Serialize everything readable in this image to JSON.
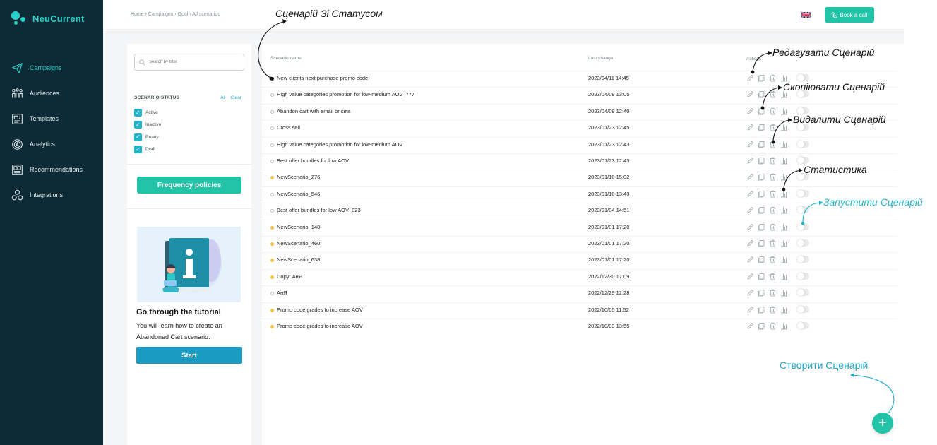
{
  "app": {
    "name": "NeuCurrent"
  },
  "sidebar": {
    "items": [
      {
        "label": "Campaigns",
        "icon": "paper-plane-icon",
        "active": true
      },
      {
        "label": "Audiences",
        "icon": "people-icon"
      },
      {
        "label": "Templates",
        "icon": "template-icon"
      },
      {
        "label": "Analytics",
        "icon": "analytics-icon"
      },
      {
        "label": "Recommendations",
        "icon": "recommendations-icon"
      },
      {
        "label": "Integrations",
        "icon": "integrations-icon"
      }
    ]
  },
  "topbar": {
    "breadcrumb": "Home › Campaigns › Goal › All scenarios",
    "language_icon": "uk-flag-icon",
    "book_call_label": "Book a call"
  },
  "filters": {
    "search_placeholder": "Search by filter",
    "status_title": "SCENARIO STATUS",
    "all_label": "All",
    "clear_label": "Clear",
    "statuses": [
      {
        "label": "Active",
        "checked": true
      },
      {
        "label": "Inactive",
        "checked": true
      },
      {
        "label": "Ready",
        "checked": true
      },
      {
        "label": "Draft",
        "checked": true
      }
    ],
    "frequency_label": "Frequency policies"
  },
  "tutorial": {
    "title": "Go through the tutorial",
    "text": "You will learn how to create an Abandoned Cart scenario.",
    "start_label": "Start"
  },
  "table": {
    "col_name": "Scenario name",
    "col_date": "Last change",
    "col_actions": "Actions",
    "rows": [
      {
        "name": "New clients next purchase promo code",
        "date": "2023/04/11 14:45",
        "status": "active"
      },
      {
        "name": "High value categories promotion for low-medium AOV_777",
        "date": "2023/04/09 13:05",
        "status": "inactive"
      },
      {
        "name": "Abandon cart with email or sms",
        "date": "2023/04/09 12:40",
        "status": "inactive"
      },
      {
        "name": "Cross sell",
        "date": "2023/01/23 12:45",
        "status": "inactive"
      },
      {
        "name": "High value categories promotion for low-medium AOV",
        "date": "2023/01/23 12:43",
        "status": "inactive"
      },
      {
        "name": "Best offer bundles for low AOV",
        "date": "2023/01/23 12:43",
        "status": "inactive"
      },
      {
        "name": "NewScenario_276",
        "date": "2023/01/10 15:02",
        "status": "draft"
      },
      {
        "name": "NewScenario_546",
        "date": "2023/01/10 13:43",
        "status": "inactive"
      },
      {
        "name": "Best offer bundles for low AOV_823",
        "date": "2023/01/04 14:51",
        "status": "inactive"
      },
      {
        "name": "NewScenario_148",
        "date": "2023/01/01 17:20",
        "status": "draft"
      },
      {
        "name": "NewScenario_460",
        "date": "2023/01/01 17:20",
        "status": "draft"
      },
      {
        "name": "NewScenario_638",
        "date": "2023/01/01 17:20",
        "status": "draft"
      },
      {
        "name": "Copy: АнЯ",
        "date": "2022/12/30 17:09",
        "status": "draft"
      },
      {
        "name": "АнЯ",
        "date": "2022/12/29 12:28",
        "status": "inactive"
      },
      {
        "name": "Promo code grades to increase AOV",
        "date": "2022/10/05 11:52",
        "status": "draft"
      },
      {
        "name": "Promo code grades to increase AOV",
        "date": "2022/10/03 13:55",
        "status": "draft"
      }
    ]
  },
  "status_colors": {
    "active": "#1a1f22",
    "inactive": "#ffffff",
    "draft": "#f2c14e"
  },
  "annotations": {
    "status": "Сценарій Зі Статусом",
    "edit": "Редагувати Сценарій",
    "copy": "Скопіювати Сценарій",
    "delete": "Видалити Сценарій",
    "stats": "Статистика",
    "launch": "Запустити Сценарій",
    "create": "Створити Сценарій"
  },
  "colors": {
    "sidebar": "#0d2b36",
    "accent": "#22c3a6",
    "link": "#1a9bc1"
  }
}
